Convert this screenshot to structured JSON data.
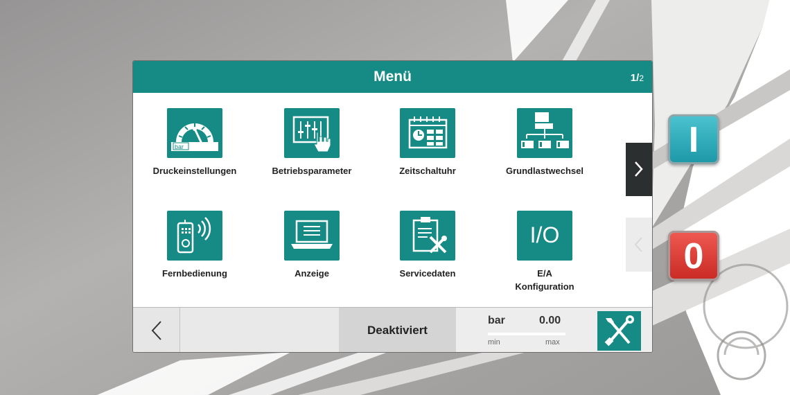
{
  "header": {
    "title": "Menü",
    "page_current": "1/",
    "page_total": "2"
  },
  "menu": {
    "items": [
      {
        "label": "Druckeinstellungen",
        "icon": "pressure-gauge-icon",
        "gauge_unit": "bar"
      },
      {
        "label": "Betriebsparameter",
        "icon": "sliders-touch-icon"
      },
      {
        "label": "Zeitschaltuhr",
        "icon": "calendar-clock-icon"
      },
      {
        "label": "Grundlastwechsel",
        "icon": "compressor-network-icon"
      },
      {
        "label": "Fernbedienung",
        "icon": "remote-control-icon"
      },
      {
        "label": "Anzeige",
        "icon": "laptop-display-icon"
      },
      {
        "label": "Servicedaten",
        "icon": "clipboard-tools-icon"
      },
      {
        "label": "E/A",
        "label_line2": "Konfiguration",
        "icon": "io-icon",
        "icon_text": "I/O"
      }
    ]
  },
  "nav": {
    "next": "chevron-right-icon",
    "prev": "chevron-left-icon"
  },
  "footer": {
    "back_icon": "chevron-left-icon",
    "status": "Deaktiviert",
    "unit": "bar",
    "value": "0.00",
    "min_label": "min",
    "max_label": "max",
    "service_icon": "tools-icon"
  },
  "hardware": {
    "on_label": "I",
    "off_label": "0"
  },
  "colors": {
    "teal": "#168b86",
    "on_button": "#2aa7b6",
    "off_button": "#d8332b",
    "dark_nav": "#2c2f30"
  }
}
